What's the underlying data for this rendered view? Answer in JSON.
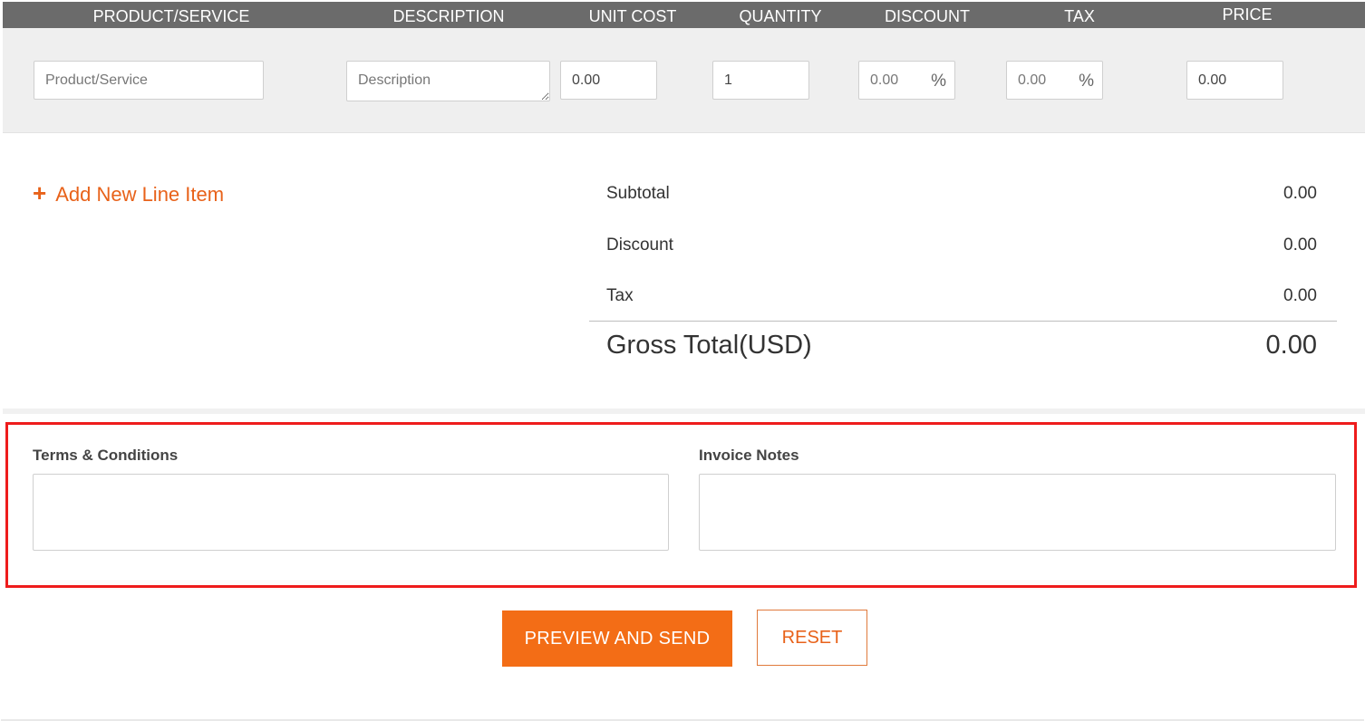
{
  "table": {
    "headers": {
      "product": "PRODUCT/SERVICE",
      "description": "DESCRIPTION",
      "unit_cost": "UNIT COST",
      "quantity": "QUANTITY",
      "discount": "DISCOUNT",
      "tax": "TAX",
      "price": "PRICE"
    }
  },
  "line_item": {
    "product_placeholder": "Product/Service",
    "description_placeholder": "Description",
    "unit_cost": "0.00",
    "quantity": "1",
    "discount_placeholder": "0.00",
    "tax_placeholder": "0.00",
    "price": "0.00",
    "percent_sign": "%"
  },
  "add_item": {
    "icon": "plus-icon",
    "plus_symbol": "+",
    "label": "Add New Line Item"
  },
  "totals": {
    "subtotal_label": "Subtotal",
    "subtotal_value": "0.00",
    "discount_label": "Discount",
    "discount_value": "0.00",
    "tax_label": "Tax",
    "tax_value": "0.00",
    "gross_label": "Gross Total(USD)",
    "gross_value": "0.00"
  },
  "notes": {
    "terms_label": "Terms & Conditions",
    "terms_value": "",
    "invoice_notes_label": "Invoice Notes",
    "invoice_notes_value": ""
  },
  "actions": {
    "preview_label": "PREVIEW AND SEND",
    "reset_label": "RESET"
  },
  "colors": {
    "accent": "#f36d16",
    "header_bg": "#6b6b6b",
    "row_bg": "#efefef",
    "highlight_border": "#ee1c1c"
  }
}
